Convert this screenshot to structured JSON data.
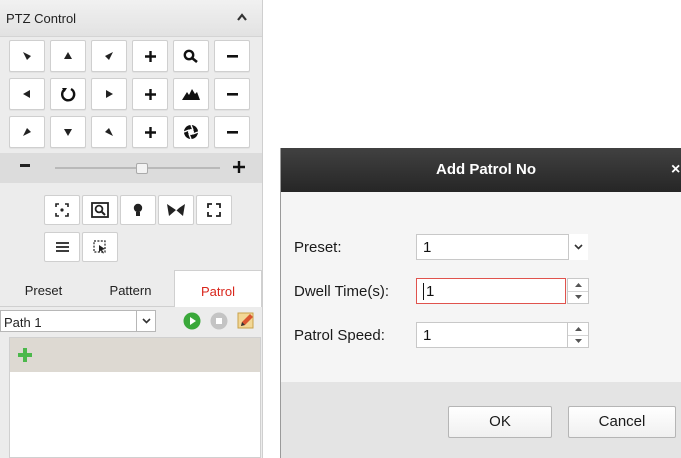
{
  "ptz": {
    "title": "PTZ Control",
    "collapse_icon": "chevron-up-icon",
    "direction_icons": [
      "arrow-up-left-icon",
      "arrow-up-icon",
      "arrow-up-right-icon",
      "arrow-left-icon",
      "auto-scan-icon",
      "arrow-right-icon",
      "arrow-down-left-icon",
      "arrow-down-icon",
      "arrow-down-right-icon"
    ],
    "zoom": {
      "icon": "zoom-icon",
      "plus": "+",
      "minus": "−"
    },
    "focus": {
      "icon": "focus-icon",
      "plus": "+",
      "minus": "−"
    },
    "iris": {
      "icon": "iris-icon",
      "plus": "+",
      "minus": "−"
    },
    "speed_slider": {
      "minus": "−",
      "plus": "+",
      "level": 0.5
    },
    "feature_icons": [
      "3d-positioning-icon",
      "zoom-area-icon",
      "light-icon",
      "wiper-icon",
      "fullscreen-icon",
      "menu-icon",
      "one-touch-focus-icon"
    ]
  },
  "tabs": [
    {
      "label": "Preset",
      "active": false
    },
    {
      "label": "Pattern",
      "active": false
    },
    {
      "label": "Patrol",
      "active": true
    }
  ],
  "patrol": {
    "path_value": "Path 1",
    "play_icon": "play-icon",
    "stop_icon": "stop-icon",
    "edit_icon": "edit-icon",
    "add_icon": "add-icon"
  },
  "dialog": {
    "title": "Add Patrol No",
    "close": "×",
    "preset_label": "Preset:",
    "preset_value": "1",
    "dwell_label": "Dwell Time(s):",
    "dwell_value": "1",
    "speed_label": "Patrol Speed:",
    "speed_value": "1",
    "ok": "OK",
    "cancel": "Cancel"
  },
  "colors": {
    "active_tab": "#d9261c",
    "title_bar": "#2c2c2c",
    "play_green": "#3aa83a",
    "add_green": "#4bb84b",
    "focus_border": "#e0534d"
  }
}
